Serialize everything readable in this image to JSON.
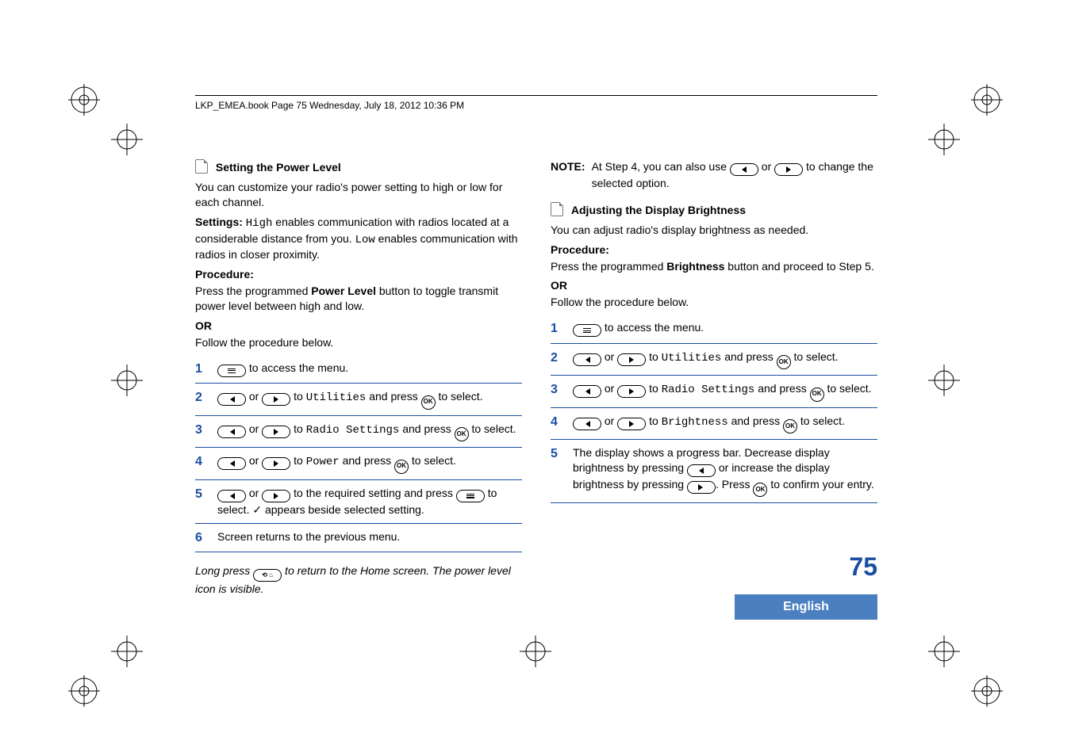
{
  "header": "LKP_EMEA.book  Page 75  Wednesday, July 18, 2012  10:36 PM",
  "page_number": "75",
  "language": "English",
  "icons": {
    "ok": "OK",
    "home_pill": "⟲ ⌂"
  },
  "left": {
    "title": "Setting the Power Level",
    "intro": "You can customize your radio's power setting to high or low for each channel.",
    "settings_label": "Settings:",
    "settings_high": "High",
    "settings_mid": " enables communication with radios located at a considerable distance from you. ",
    "settings_low": "Low",
    "settings_end": " enables communication with radios in closer proximity.",
    "procedure_label": "Procedure:",
    "press_pre": "Press the programmed ",
    "press_bold": "Power Level",
    "press_post": " button to toggle transmit power level between high and low.",
    "or": "OR",
    "follow": "Follow the procedure below.",
    "steps": {
      "s1_post": " to access the menu.",
      "s2_mid": " to ",
      "s2_util": "Utilities",
      "s2_press": " and press ",
      "s2_end": " to select.",
      "s3_rs": "Radio Settings",
      "s4_power": "Power",
      "s5_mid": " to the required setting and press ",
      "s5_end1": " to select. ",
      "s5_check": "✓",
      "s5_end2": " appears beside selected setting.",
      "s6": "Screen returns to the previous menu."
    },
    "footer_pre": "Long press ",
    "footer_post": " to return to the Home screen. The power level icon is visible."
  },
  "right": {
    "note_label": "NOTE:",
    "note_pre": "At Step 4, you can also use ",
    "note_mid": " or ",
    "note_post": " to change the selected option.",
    "title": "Adjusting the Display Brightness",
    "intro": "You can adjust radio's display brightness as needed.",
    "procedure_label": "Procedure:",
    "press_pre": "Press the programmed ",
    "press_bold": "Brightness",
    "press_post": " button and proceed to Step 5.",
    "or": "OR",
    "follow": "Follow the procedure below.",
    "steps": {
      "s1_post": " to access the menu.",
      "mid_or": " or ",
      "mid_to": " to ",
      "press": " and press ",
      "select": " to select.",
      "util": "Utilities",
      "rs": "Radio Settings",
      "bright": "Brightness",
      "s5a": "The display shows a progress bar. Decrease display brightness by pressing ",
      "s5b": " or increase the display brightness by pressing ",
      "s5c": ". Press ",
      "s5d": " to confirm your entry."
    }
  }
}
